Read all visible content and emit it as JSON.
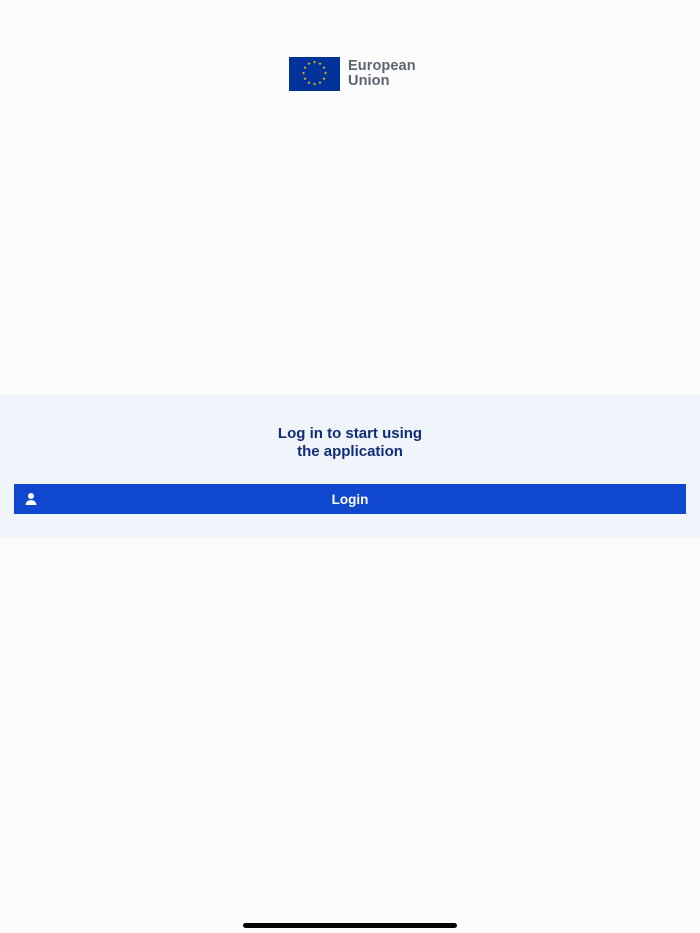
{
  "branding": {
    "logo_line1": "European",
    "logo_line2": "Union"
  },
  "login_panel": {
    "prompt_line1": "Log in to start using",
    "prompt_line2": "the application",
    "login_label": "Login",
    "login_icon": "user-icon"
  },
  "colors": {
    "page_background": "#fcfcfc",
    "panel_background": "#f0f4fb",
    "primary_button": "#0f47cf",
    "heading_text": "#0e2d7a",
    "logo_text": "#5b6470",
    "flag_blue": "#003399",
    "flag_star": "#ffcc00"
  }
}
